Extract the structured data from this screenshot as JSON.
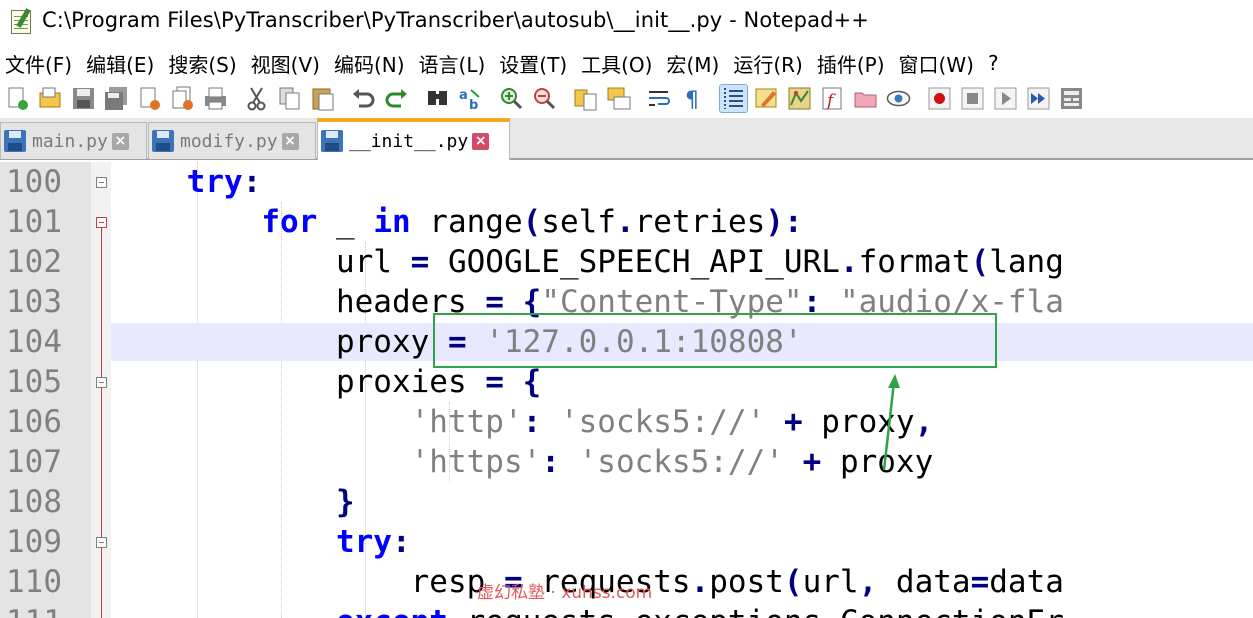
{
  "window": {
    "title": "C:\\Program Files\\PyTranscriber\\PyTranscriber\\autosub\\__init__.py - Notepad++"
  },
  "menu": [
    "文件(F)",
    "编辑(E)",
    "搜索(S)",
    "视图(V)",
    "编码(N)",
    "语言(L)",
    "设置(T)",
    "工具(O)",
    "宏(M)",
    "运行(R)",
    "插件(P)",
    "窗口(W)",
    "?"
  ],
  "tabs": [
    {
      "label": "main.py",
      "active": false
    },
    {
      "label": "modify.py",
      "active": false
    },
    {
      "label": "__init__.py",
      "active": true
    }
  ],
  "editor": {
    "current_line": "104",
    "lines": [
      {
        "num": "100"
      },
      {
        "num": "101"
      },
      {
        "num": "102"
      },
      {
        "num": "103"
      },
      {
        "num": "104"
      },
      {
        "num": "105"
      },
      {
        "num": "106"
      },
      {
        "num": "107"
      },
      {
        "num": "108"
      },
      {
        "num": "109"
      },
      {
        "num": "110"
      },
      {
        "num": "111"
      }
    ]
  },
  "annotation": {
    "watermark": "虚幻私塾 · xuhss.com",
    "box_color": "#2ea34a"
  },
  "colors": {
    "keyword": "#0000ff",
    "string": "#808080",
    "operator": "#000080",
    "tab_accent": "#f5a623",
    "current_line_bg": "#e8e8ff"
  }
}
